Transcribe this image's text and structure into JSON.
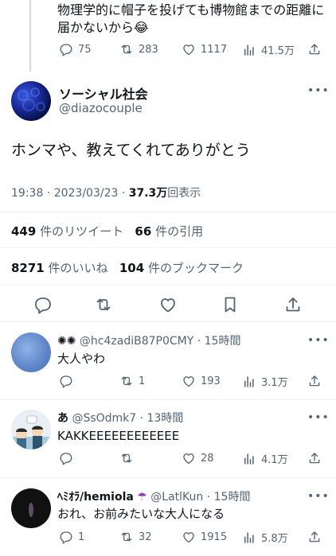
{
  "parent": {
    "text": "物理学的に帽子を投げても博物館までの距離に届かないから😂",
    "reply_count": "75",
    "retweet_count": "283",
    "like_count": "1117",
    "view_count": "41.5万"
  },
  "main": {
    "display_name": "ソーシャル社会",
    "handle": "@diazocouple",
    "text": "ホンマや、教えてくれてありがとう",
    "time": "19:38 · 2023/03/23 · ",
    "views": "37.3万",
    "views_label": "回表示",
    "retweets": "449",
    "retweets_label": "件のリツイート",
    "quotes": "66",
    "quotes_label": "件の引用",
    "likes": "8271",
    "likes_label": "件のいいね",
    "bookmarks": "104",
    "bookmarks_label": "件のブックマーク"
  },
  "replies": [
    {
      "name": "✺✺",
      "handle": "@hc4zadiB87P0CMY",
      "time": "· 15時間",
      "text": "大人やわ",
      "reply_count": "",
      "retweet_count": "1",
      "like_count": "193",
      "view_count": "3.1万"
    },
    {
      "name": "あ",
      "handle": "@SsOdmk7",
      "time": "· 13時間",
      "text": "KAKKEEEEEEEEEEEE",
      "reply_count": "",
      "retweet_count": "",
      "like_count": "28",
      "view_count": "4.1万"
    },
    {
      "name": "ﾍﾐｵﾗ/hemiola",
      "handle": "@LatlKun",
      "time": "· 15時間",
      "text": "おれ、お前みたいな大人になる",
      "reply_count": "1",
      "retweet_count": "32",
      "like_count": "1915",
      "view_count": "5.8万"
    }
  ],
  "icons": {
    "reply": "reply-icon",
    "retweet": "retweet-icon",
    "like": "heart-icon",
    "views": "views-icon",
    "share": "share-icon",
    "bookmark": "bookmark-icon",
    "more": "more-icon"
  },
  "colors": {
    "text": "#0f1419",
    "muted": "#536471",
    "divider": "#eff3f4"
  }
}
